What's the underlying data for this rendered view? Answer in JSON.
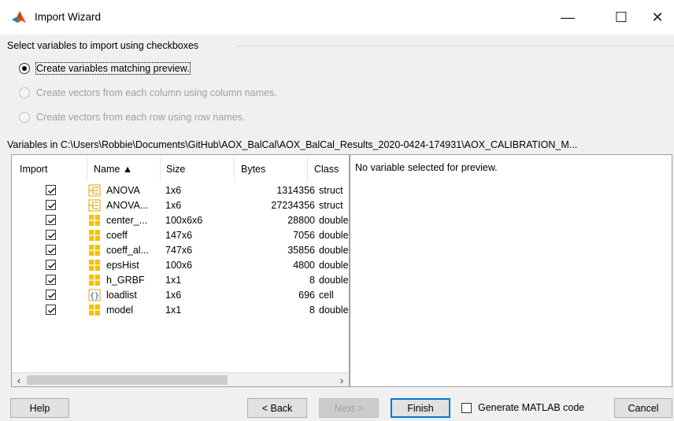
{
  "window": {
    "title": "Import Wizard",
    "minimize": "—",
    "maximize": "☐",
    "close": "✕"
  },
  "options": {
    "group_title": "Select variables to import using checkboxes",
    "radios": [
      {
        "label": "Create variables matching preview.",
        "checked": true,
        "enabled": true
      },
      {
        "label": "Create vectors from each column using column names.",
        "checked": false,
        "enabled": false
      },
      {
        "label": "Create vectors from each row using row names.",
        "checked": false,
        "enabled": false
      }
    ]
  },
  "variables_path": "Variables in C:\\Users\\Robbie\\Documents\\GitHub\\AOX_BalCal\\AOX_BalCal_Results_2020-0424-174931\\AOX_CALIBRATION_M...",
  "table": {
    "columns": {
      "import": "Import",
      "name": "Name ▲",
      "size": "Size",
      "bytes": "Bytes",
      "class": "Class"
    },
    "rows": [
      {
        "checked": true,
        "icon": "struct-icon",
        "name": "ANOVA",
        "size": "1x6",
        "bytes": "1314356",
        "class": "struct"
      },
      {
        "checked": true,
        "icon": "struct-icon",
        "name": "ANOVA...",
        "size": "1x6",
        "bytes": "27234356",
        "class": "struct"
      },
      {
        "checked": true,
        "icon": "matrix-icon",
        "name": "center_...",
        "size": "100x6x6",
        "bytes": "28800",
        "class": "double"
      },
      {
        "checked": true,
        "icon": "matrix-icon",
        "name": "coeff",
        "size": "147x6",
        "bytes": "7056",
        "class": "double"
      },
      {
        "checked": true,
        "icon": "matrix-icon",
        "name": "coeff_al...",
        "size": "747x6",
        "bytes": "35856",
        "class": "double"
      },
      {
        "checked": true,
        "icon": "matrix-icon",
        "name": "epsHist",
        "size": "100x6",
        "bytes": "4800",
        "class": "double"
      },
      {
        "checked": true,
        "icon": "matrix-icon",
        "name": "h_GRBF",
        "size": "1x1",
        "bytes": "8",
        "class": "double"
      },
      {
        "checked": true,
        "icon": "cell-icon",
        "name": "loadlist",
        "size": "1x6",
        "bytes": "696",
        "class": "cell"
      },
      {
        "checked": true,
        "icon": "matrix-icon",
        "name": "model",
        "size": "1x1",
        "bytes": "8",
        "class": "double"
      }
    ]
  },
  "preview": {
    "text": "No variable selected for preview."
  },
  "buttons": {
    "help": "Help",
    "back": "< Back",
    "next": "Next >",
    "finish": "Finish",
    "generate_code": "Generate MATLAB code",
    "cancel": "Cancel"
  },
  "colors": {
    "accent": "#0078d7",
    "struct_icon": "#e8a000",
    "matrix_icon": "#f2c300"
  }
}
